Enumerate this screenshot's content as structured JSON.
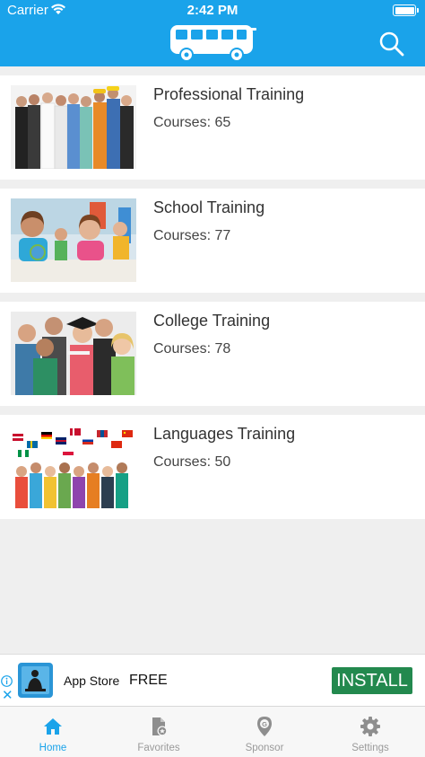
{
  "status": {
    "carrier": "Carrier",
    "time": "2:42 PM"
  },
  "header": {
    "logo_icon": "bus-icon",
    "search_icon": "search-icon"
  },
  "courses": [
    {
      "title": "Professional Training",
      "count": "Courses: 65",
      "image": "professionals-group-photo"
    },
    {
      "title": "School Training",
      "count": "Courses: 77",
      "image": "school-children-photo"
    },
    {
      "title": "College Training",
      "count": "Courses: 78",
      "image": "college-students-photo"
    },
    {
      "title": "Languages Training",
      "count": "Courses: 50",
      "image": "people-with-flags-photo"
    }
  ],
  "ad": {
    "store": "App Store",
    "price": "FREE",
    "install": "INSTALL"
  },
  "tabs": [
    {
      "label": "Home",
      "icon": "home-icon",
      "active": true
    },
    {
      "label": "Favorites",
      "icon": "favorites-icon",
      "active": false
    },
    {
      "label": "Sponsor",
      "icon": "sponsor-icon",
      "active": false
    },
    {
      "label": "Settings",
      "icon": "gear-icon",
      "active": false
    }
  ],
  "colors": {
    "primary": "#1aa3ea",
    "install": "#23894e",
    "background": "#efefef"
  }
}
